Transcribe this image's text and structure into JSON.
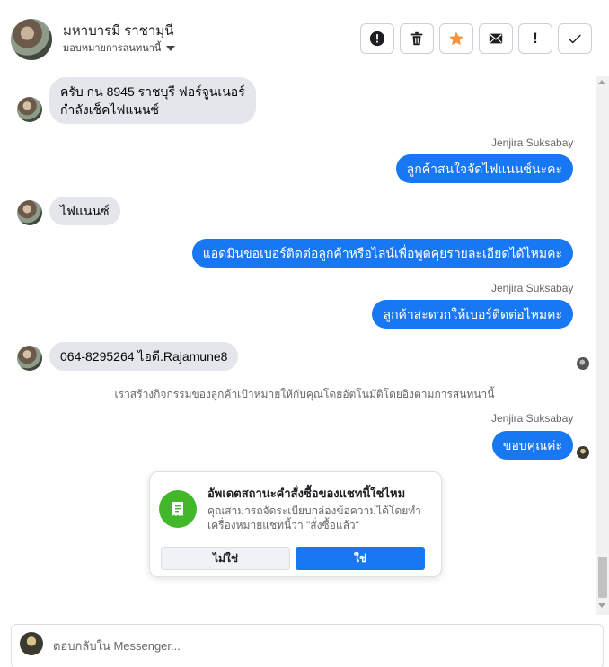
{
  "header": {
    "contact_name": "มหาบารมี ราชามุนี",
    "assign_label": "มอบหมายการสนทนานี้",
    "actions": [
      {
        "name": "block-button",
        "icon": "block-icon"
      },
      {
        "name": "delete-button",
        "icon": "trash-icon"
      },
      {
        "name": "star-button",
        "icon": "star-icon"
      },
      {
        "name": "mark-unread-button",
        "icon": "envelope-icon"
      },
      {
        "name": "spam-button",
        "icon": "exclamation-icon"
      },
      {
        "name": "done-button",
        "icon": "check-icon"
      }
    ],
    "accent_star": "#f7923b"
  },
  "messages": [
    {
      "dir": "in",
      "text_lines": [
        "ครับ กน 8945 ราชบุรี ฟอร์จูนเนอร์",
        "กำลังเช็คไฟแนนซ์"
      ]
    },
    {
      "dir": "out",
      "sender": "Jenjira Suksabay",
      "text": "ลูกค้าสนใจจัดไฟแนนซ์นะคะ"
    },
    {
      "dir": "in",
      "text": "ไฟแนนซ์"
    },
    {
      "dir": "out",
      "text": "แอดมินขอเบอร์ติดต่อลูกค้าหรือไลน์เพื่อพูดคุยรายละเอียดได้ไหมคะ"
    },
    {
      "dir": "out",
      "sender": "Jenjira Suksabay",
      "text": "ลูกค้าสะดวกให้เบอร์ติดต่อไหมคะ"
    },
    {
      "dir": "in",
      "text": "064-8295264  ไอดี.Rajamune8"
    },
    {
      "dir": "out",
      "sender": "Jenjira Suksabay",
      "text": "ขอบคุณค่ะ"
    }
  ],
  "system_note": "เราสร้างกิจกรรมของลูกค้าเป้าหมายให้กับคุณโดยอัตโนมัติโดยอิงตามการสนทนานี้",
  "card": {
    "title": "อัพเดตสถานะคำสั่งซื้อของแชทนี้ใช่ไหม",
    "text": "คุณสามารถจัดระเบียบกล่องข้อความได้โดยทำเครื่องหมายแชทนี้ว่า \"สั่งซื้อแล้ว\"",
    "no_label": "ไม่ใช่",
    "yes_label": "ใช่",
    "icon": "receipt-icon"
  },
  "composer": {
    "placeholder": "ตอบกลับใน Messenger..."
  },
  "colors": {
    "outgoing_bubble": "#1877f2",
    "incoming_bubble": "#e4e6eb",
    "card_icon": "#42b72a"
  }
}
